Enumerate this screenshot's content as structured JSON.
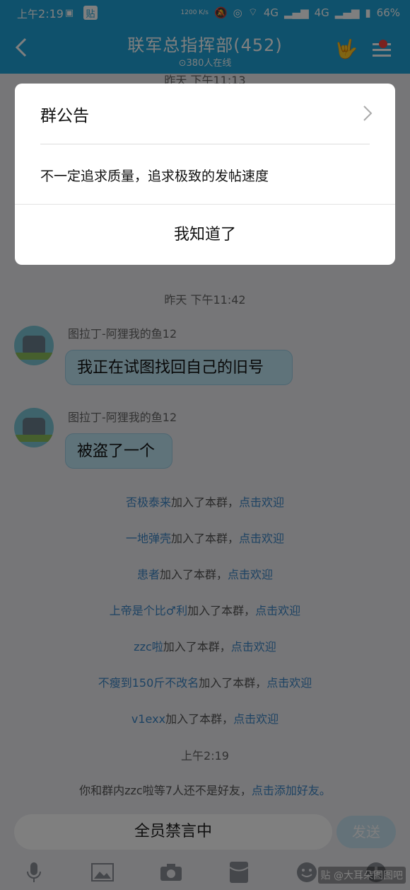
{
  "statusbar": {
    "time_prefix": "上午",
    "time": "2:19",
    "battery": "66%",
    "net1": "4G",
    "net2": "4G",
    "tieba_icon": "贴",
    "kb": "1200 K/s"
  },
  "header": {
    "title": "联军总指挥部(452)",
    "subtitle": "⊙380人在线"
  },
  "chat": {
    "time_top": "昨天 下午11:13",
    "time_mid": "昨天 下午11:42",
    "messages": [
      {
        "sender": "图拉丁-阿狸我的鱼12",
        "text": "我正在试图找回自己的旧号"
      },
      {
        "sender": "图拉丁-阿狸我的鱼12",
        "text": "被盗了一个"
      }
    ],
    "joins": [
      {
        "name": "否极泰来",
        "mid": "加入了本群，",
        "link": "点击欢迎"
      },
      {
        "name": "一地弹壳",
        "mid": "加入了本群，",
        "link": "点击欢迎"
      },
      {
        "name": "患者",
        "mid": "加入了本群，",
        "link": "点击欢迎"
      },
      {
        "name": "上帝是个比♂利",
        "mid": "加入了本群，",
        "link": "点击欢迎"
      },
      {
        "name": "zzc啦",
        "mid": "加入了本群，",
        "link": "点击欢迎"
      },
      {
        "name": "不瘦到150斤不改名",
        "mid": "加入了本群，",
        "link": "点击欢迎"
      },
      {
        "name": "v1exx",
        "mid": "加入了本群，",
        "link": "点击欢迎"
      }
    ],
    "time_last": "上午2:19",
    "friend_note": "你和群内zzc啦等7人还不是好友，",
    "friend_link": "点击添加好友。"
  },
  "input": {
    "value": "全员禁言中",
    "send_label": "发送"
  },
  "watermark": "贴 @大耳朵图图吧",
  "dialog": {
    "title": "群公告",
    "body": "不一定追求质量，追求极致的发帖速度",
    "button": "我知道了"
  },
  "colors": {
    "header_bg": "#1fa3d8",
    "link": "#3d86c6",
    "bubble": "#bfe6f5"
  },
  "icons": [
    "back-icon",
    "chevron-right-icon",
    "mic-icon",
    "image-icon",
    "camera-icon",
    "redpacket-icon",
    "emoji-icon",
    "plus-icon"
  ]
}
